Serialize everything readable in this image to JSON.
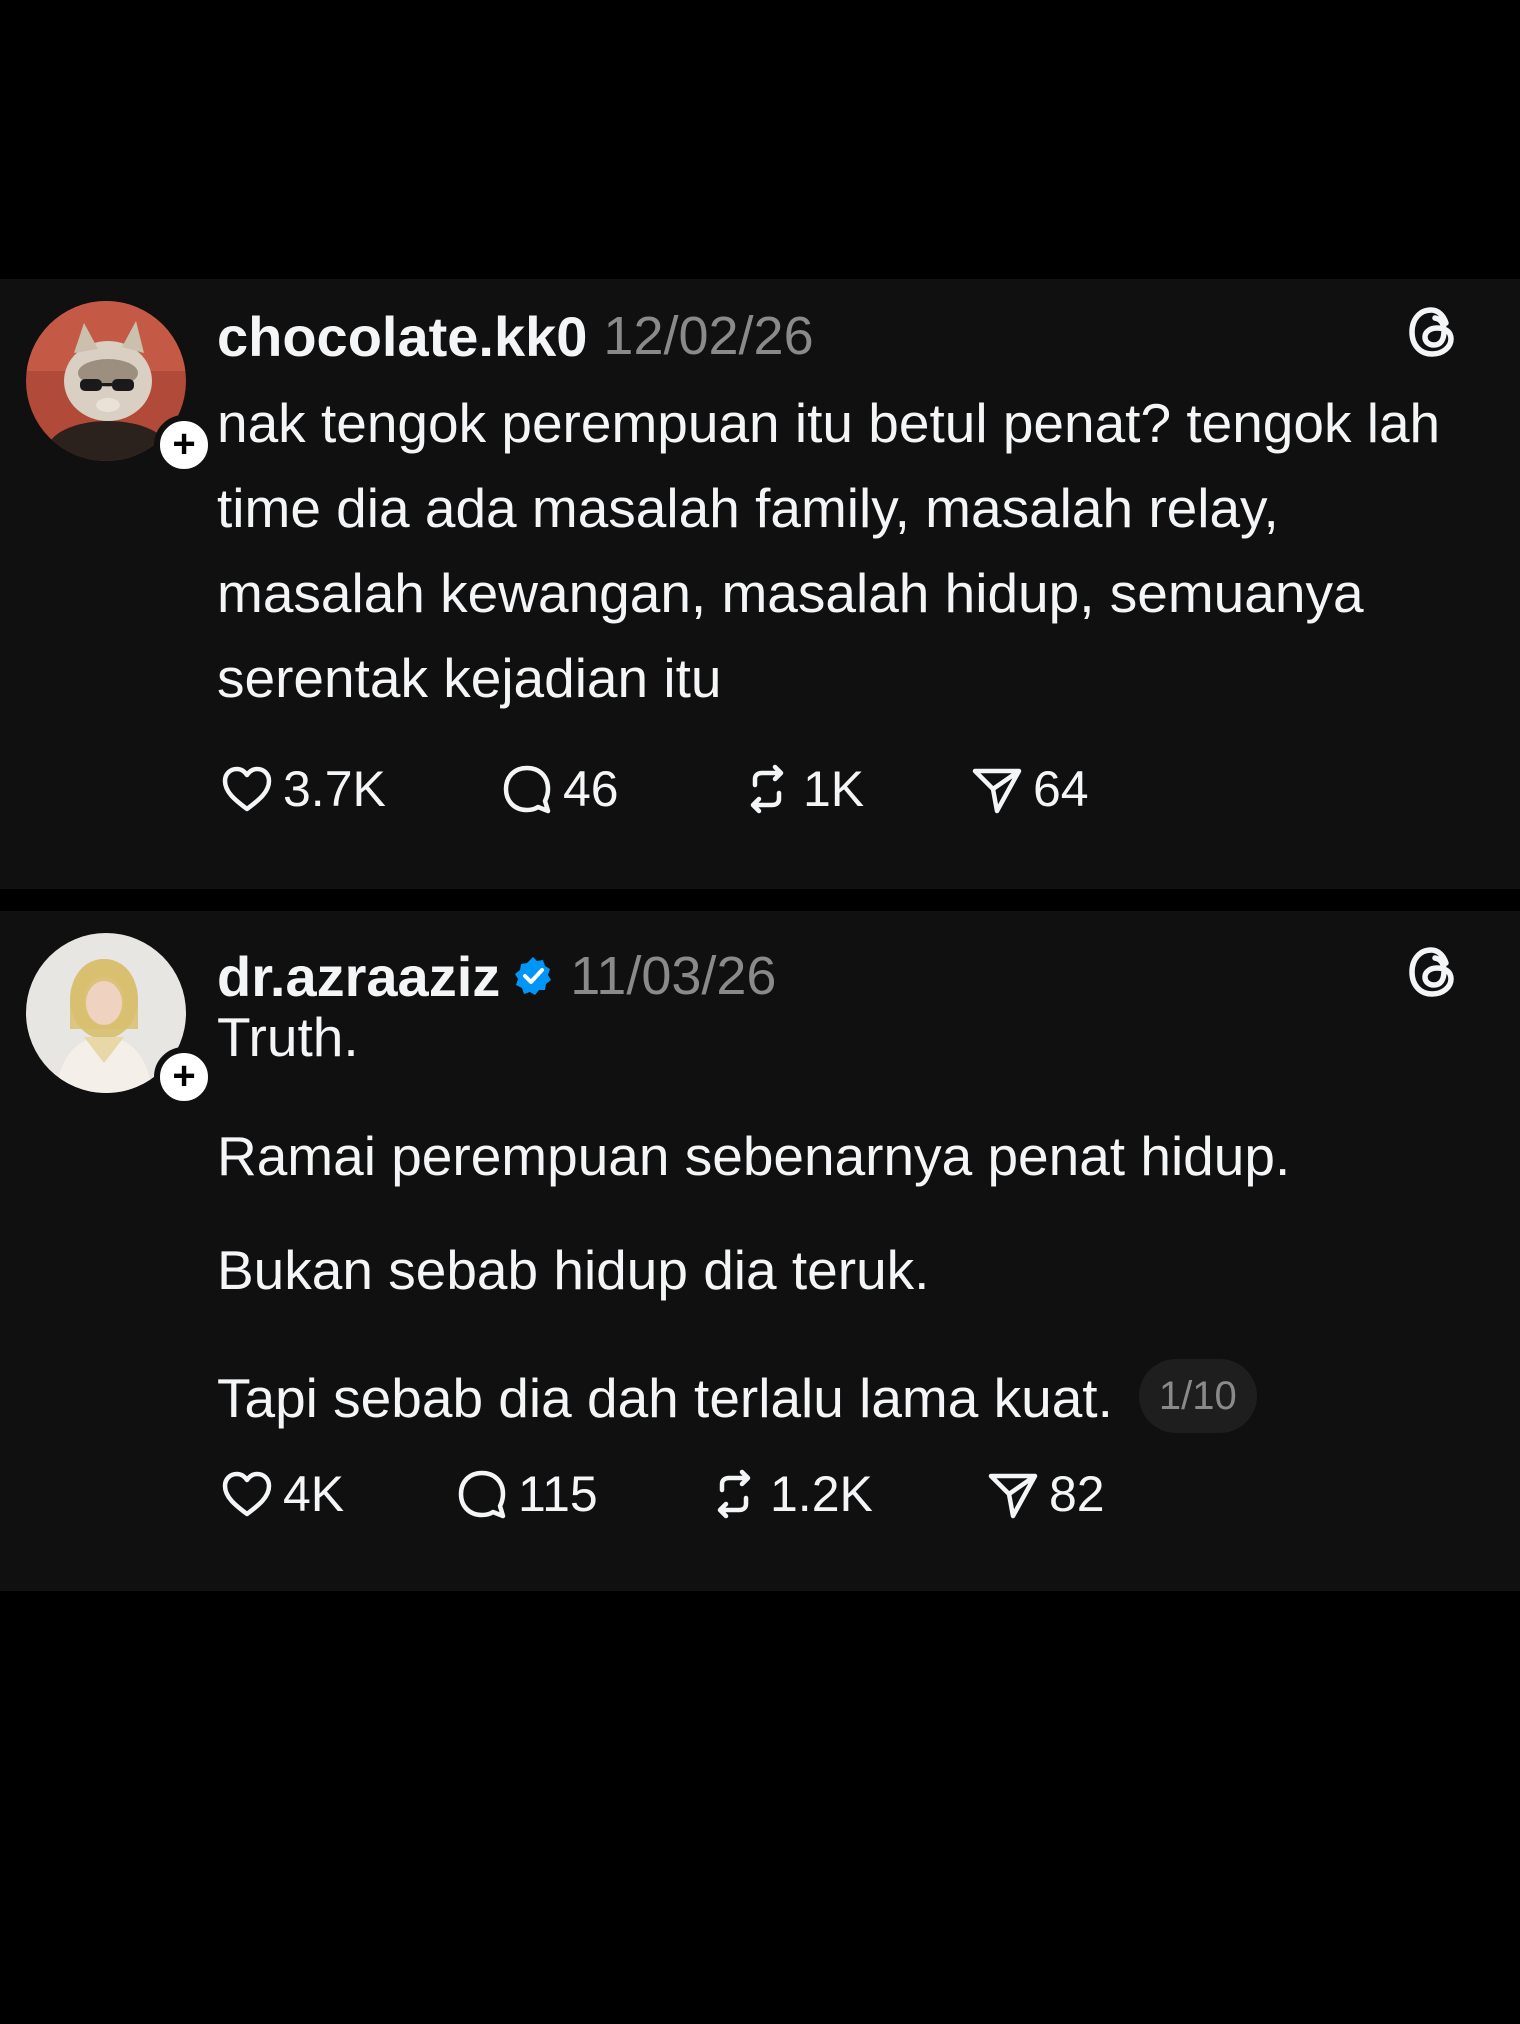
{
  "posts": [
    {
      "username": "chocolate.kk0",
      "date": "12/02/26",
      "verified": false,
      "follow_label": "+",
      "text": "nak tengok perempuan itu betul penat? tengok lah time dia ada masalah family, masalah relay, masalah kewangan, masalah hidup, semuanya serentak kejadian itu",
      "stats": {
        "likes": "3.7K",
        "replies": "46",
        "reposts": "1K",
        "shares": "64"
      }
    },
    {
      "username": "dr.azraaziz",
      "date": "11/03/26",
      "verified": true,
      "follow_label": "+",
      "paragraphs": [
        "Truth.",
        "Ramai perempuan sebenarnya penat hidup.",
        "Bukan sebab hidup dia teruk.",
        "Tapi sebab dia dah terlalu lama kuat."
      ],
      "page_indicator": "1/10",
      "stats": {
        "likes": "4K",
        "replies": "115",
        "reposts": "1.2K",
        "shares": "82"
      }
    }
  ],
  "icons": {
    "like": "heart-icon",
    "reply": "comment-icon",
    "repost": "repost-icon",
    "share": "share-icon",
    "brand": "threads-logo-icon",
    "verified": "verified-badge-icon"
  },
  "colors": {
    "card_background": "#101010",
    "page_background": "#000000",
    "text_primary": "#f3f5f7",
    "text_secondary": "#8a8a8a",
    "verified_blue": "#0095f6"
  }
}
